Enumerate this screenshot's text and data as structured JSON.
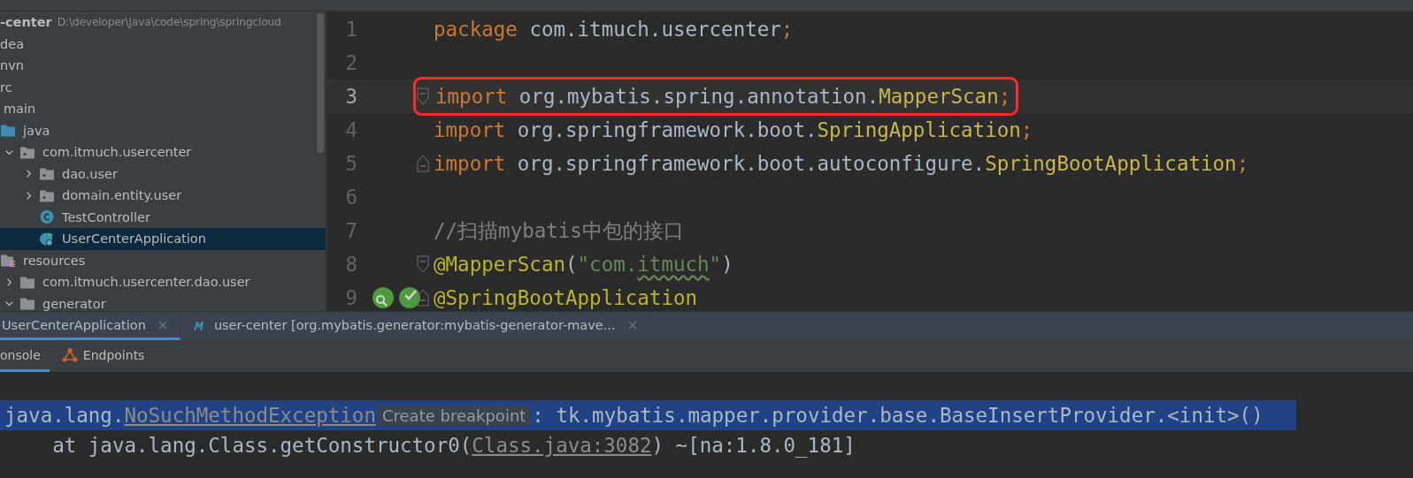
{
  "project": {
    "name": "-center",
    "path": "D:\\developer\\java\\code\\spring\\springcloud"
  },
  "tree": [
    {
      "label": "dea"
    },
    {
      "label": "nvn"
    },
    {
      "label": "rc",
      "children": [
        {
          "label": "main",
          "children": [
            {
              "label": "java",
              "kind": "source",
              "children": [
                {
                  "label": "com.itmuch.usercenter",
                  "kind": "package",
                  "expanded": true,
                  "selected": false,
                  "children": [
                    {
                      "label": "dao.user",
                      "kind": "package",
                      "expanded": false,
                      "selected": false
                    },
                    {
                      "label": "domain.entity.user",
                      "kind": "package",
                      "expanded": false,
                      "selected": false
                    },
                    {
                      "label": "TestController",
                      "kind": "class",
                      "selected": false
                    },
                    {
                      "label": "UserCenterApplication",
                      "kind": "app",
                      "selected": true
                    }
                  ]
                }
              ]
            },
            {
              "label": "resources",
              "kind": "resources",
              "children": [
                {
                  "label": "com.itmuch.usercenter.dao.user",
                  "kind": "folder",
                  "expanded": false,
                  "selected": false
                },
                {
                  "label": "generator",
                  "kind": "folder",
                  "expanded": true,
                  "selected": false
                }
              ]
            }
          ]
        }
      ]
    }
  ],
  "editor": {
    "lines": [
      {
        "number": "1",
        "kind": "plain",
        "tokens": [
          {
            "kind": "keyword",
            "text": "package "
          },
          {
            "kind": "plain",
            "text": "com.itmuch.usercenter"
          },
          {
            "kind": "keyword",
            "text": ";"
          }
        ]
      },
      {
        "number": "2",
        "kind": "plain"
      },
      {
        "number": "3",
        "kind": "fold-start",
        "current": true,
        "boxed": true,
        "tokens": [
          {
            "kind": "keyword",
            "text": "import "
          },
          {
            "kind": "plain",
            "text": "org.mybatis.spring.annotation."
          },
          {
            "kind": "class",
            "text": "MapperScan"
          },
          {
            "kind": "keyword",
            "text": ";"
          }
        ]
      },
      {
        "number": "4",
        "kind": "plain",
        "tokens": [
          {
            "kind": "keyword",
            "text": "import "
          },
          {
            "kind": "plain",
            "text": "org.springframework.boot."
          },
          {
            "kind": "class",
            "text": "SpringApplication"
          },
          {
            "kind": "keyword",
            "text": ";"
          }
        ]
      },
      {
        "number": "5",
        "kind": "fold-end",
        "tokens": [
          {
            "kind": "keyword",
            "text": "import "
          },
          {
            "kind": "plain",
            "text": "org.springframework.boot.autoconfigure."
          },
          {
            "kind": "class",
            "text": "SpringBootApplication"
          },
          {
            "kind": "keyword",
            "text": ";"
          }
        ]
      },
      {
        "number": "6",
        "kind": "plain"
      },
      {
        "number": "7",
        "kind": "plain",
        "tokens": [
          {
            "kind": "comment",
            "text": "//扫描mybatis中包的接口"
          }
        ]
      },
      {
        "number": "8",
        "kind": "fold-start",
        "tokens": [
          {
            "kind": "annotation",
            "text": "@MapperScan"
          },
          {
            "kind": "plain",
            "text": "("
          },
          {
            "kind": "string",
            "text": "\"com."
          },
          {
            "kind": "typo",
            "text": "itmuch"
          },
          {
            "kind": "string",
            "text": "\""
          },
          {
            "kind": "plain",
            "text": ")"
          }
        ]
      },
      {
        "number": "9",
        "kind": "fold-end",
        "markers": true,
        "tokens": [
          {
            "kind": "annotation",
            "text": "@SpringBootApplication"
          }
        ]
      }
    ]
  },
  "run_tabs": [
    {
      "label": "UserCenterApplication",
      "kind": "plain",
      "selected": true
    },
    {
      "label": "user-center [org.mybatis.generator:mybatis-generator-mave...",
      "kind": "maven",
      "selected": false
    }
  ],
  "sub_tabs": [
    {
      "label": "onsole",
      "kind": "plain",
      "selected": true
    },
    {
      "label": "Endpoints",
      "kind": "endpoints",
      "selected": false
    }
  ],
  "console": [
    {
      "highlighted": true,
      "segments": [
        {
          "kind": "text",
          "text": "java.lang."
        },
        {
          "kind": "link",
          "text": "NoSuchMethodException"
        },
        {
          "kind": "chip",
          "text": "Create breakpoint"
        },
        {
          "kind": "text",
          "text": ": tk.mybatis.mapper.provider.base.BaseInsertProvider.<init>()"
        }
      ]
    },
    {
      "highlighted": false,
      "segments": [
        {
          "kind": "text",
          "text": "    at java.lang.Class.getConstructor0("
        },
        {
          "kind": "link",
          "text": "Class.java:3082"
        },
        {
          "kind": "text",
          "text": ") ~[na:1.8.0_181]"
        }
      ]
    }
  ]
}
